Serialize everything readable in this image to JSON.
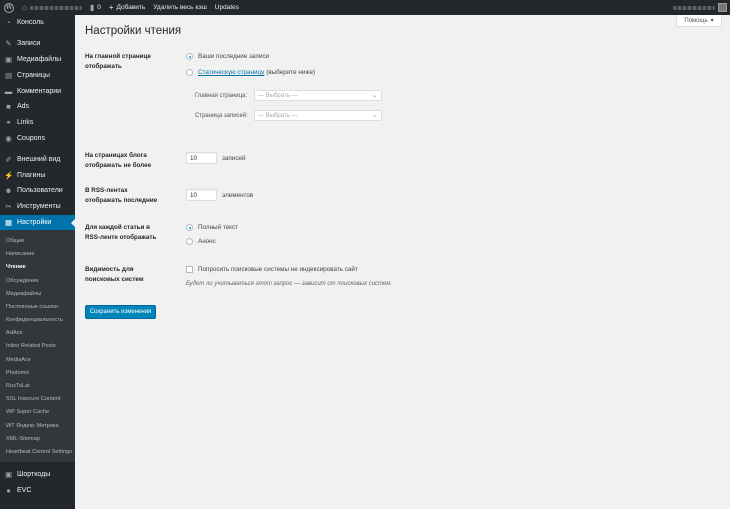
{
  "adminbar": {
    "comments_count": "0",
    "add_label": "Добавить",
    "clear_cache_label": "Удалить весь кэш",
    "updates_label": "Updates"
  },
  "sidebar": {
    "top_items": [
      {
        "label": "Консоль",
        "icon": "dashboard-icon",
        "glyph": "◔"
      }
    ],
    "items": [
      {
        "label": "Записи",
        "icon": "pin-icon",
        "glyph": "✎"
      },
      {
        "label": "Медиафайлы",
        "icon": "media-icon",
        "glyph": "▣"
      },
      {
        "label": "Страницы",
        "icon": "pages-icon",
        "glyph": "▤"
      },
      {
        "label": "Комментарии",
        "icon": "comments-icon",
        "glyph": "▬"
      },
      {
        "label": "Ads",
        "icon": "ads-icon",
        "glyph": "■"
      },
      {
        "label": "Links",
        "icon": "links-icon",
        "glyph": "⚭"
      },
      {
        "label": "Coupons",
        "icon": "coupons-icon",
        "glyph": "◉"
      }
    ],
    "items2": [
      {
        "label": "Внешний вид",
        "icon": "appearance-icon",
        "glyph": "✐"
      },
      {
        "label": "Плагины",
        "icon": "plugins-icon",
        "glyph": "⚡"
      },
      {
        "label": "Пользователи",
        "icon": "users-icon",
        "glyph": "☻"
      },
      {
        "label": "Инструменты",
        "icon": "tools-icon",
        "glyph": "✂"
      }
    ],
    "current": {
      "label": "Настройки",
      "icon": "settings-icon",
      "glyph": "▦"
    },
    "submenu": [
      "Общие",
      "Написание",
      "Чтение",
      "Обсуждение",
      "Медиафайлы",
      "Постоянные ссылки",
      "Конфиденциальность",
      "AdAce",
      "Inline Related Posts",
      "MediaAce",
      "Photomix",
      "RusToLat",
      "SSL Insecure Content",
      "WP Super Cache",
      "WT Яндекс Метрика",
      "XML-Sitemap",
      "Heartbeat Control Settings"
    ],
    "current_sub_index": 2,
    "bottom_items": [
      {
        "label": "Шорткоды",
        "icon": "shortcodes-icon",
        "glyph": "▣"
      },
      {
        "label": "EVC",
        "icon": "evc-icon",
        "glyph": "●"
      }
    ]
  },
  "page": {
    "help_label": "Помощь",
    "title": "Настройки чтения",
    "front_label": "На главной странице отображать",
    "front_opt1": "Ваши последние записи",
    "front_opt2_link": "Статическую страницу",
    "front_opt2_rest": "(выберите ниже)",
    "front_page_label": "Главная страница:",
    "front_page_value": "— Выбрать —",
    "posts_page_label": "Страница записей:",
    "posts_page_value": "— Выбрать —",
    "per_page_label": "На страницах блога отображать не более",
    "per_page_value": "10",
    "per_page_unit": "записей",
    "rss_label": "В RSS-лентах отображать последние",
    "rss_value": "10",
    "rss_unit": "элементов",
    "feed_label": "Для каждой статьи в RSS-ленте отображать",
    "feed_opt1": "Полный текст",
    "feed_opt2": "Анонс",
    "visibility_label": "Видимость для поисковых систем",
    "visibility_checkbox": "Попросить поисковые системы не индексировать сайт",
    "visibility_desc": "Будет ли учитываться этот запрос — зависит от поисковых систем.",
    "save_label": "Сохранить изменения"
  }
}
